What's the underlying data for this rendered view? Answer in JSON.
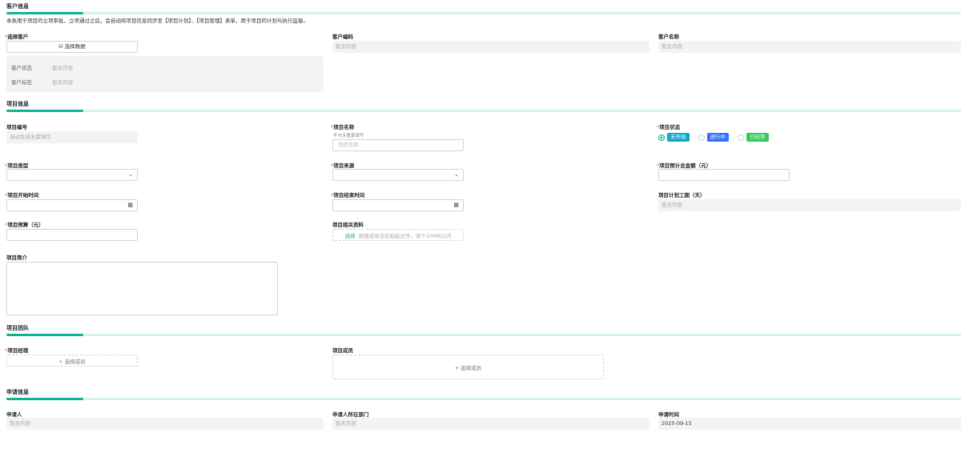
{
  "customer": {
    "title": "客户信息",
    "description": "本表用于项目的立项审批，立项通过之后，会自动将项目信息同步至【项目计划】、【项目管理】表单，用于项目的计划与执行监督。",
    "select_label": "选择客户",
    "select_button": "选择数据",
    "code_label": "客户编码",
    "code_value": "暂无内容",
    "name_label": "客户名称",
    "name_value": "暂无内容",
    "status_label": "客户状态",
    "status_value": "暂无内容",
    "tag_label": "客户标签",
    "tag_value": "暂无内容"
  },
  "project": {
    "title": "项目信息",
    "number_label": "项目编号",
    "number_placeholder": "自动生成无需填写",
    "name_label": "项目名称",
    "name_hint": "不允许重复填写",
    "name_placeholder": "项目名称",
    "status_label": "项目状态",
    "status_options": [
      {
        "label": "未开始",
        "color": "#10a8c9",
        "selected": true
      },
      {
        "label": "进行中",
        "color": "#3370ff",
        "selected": false
      },
      {
        "label": "已结项",
        "color": "#34c759",
        "selected": false
      }
    ],
    "type_label": "项目类型",
    "source_label": "项目来源",
    "total_label": "项目预计总金额（元）",
    "start_label": "项目开始时间",
    "end_label": "项目结束时间",
    "duration_label": "项目计划工期（天）",
    "duration_value": "暂无内容",
    "budget_label": "项目预算（元）",
    "files_label": "项目相关资料",
    "files_select": "选择",
    "files_hint": "拖拽或单击后粘贴文件，单个20MB以内",
    "intro_label": "项目简介"
  },
  "team": {
    "title": "项目团队",
    "manager_label": "项目经理",
    "manager_button": "+ 选择成员",
    "members_label": "项目成员",
    "members_button": "+ 选择成员"
  },
  "apply": {
    "title": "申请信息",
    "applicant_label": "申请人",
    "applicant_value": "暂无内容",
    "dept_label": "申请人所在部门",
    "dept_value": "暂无内容",
    "time_label": "申请时间",
    "time_value": "2025-09-15"
  }
}
